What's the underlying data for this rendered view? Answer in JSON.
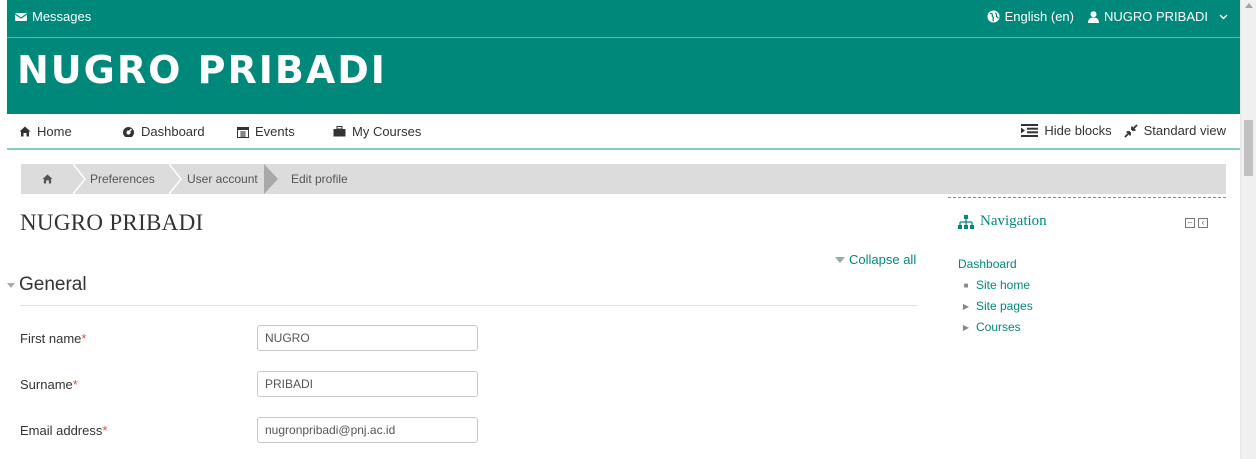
{
  "topbar": {
    "messages_label": "Messages",
    "language_label": "English (en)",
    "user_label": "NUGRO PRIBADI"
  },
  "header": {
    "site_name": "NUGRO PRIBADI"
  },
  "nav": {
    "items": [
      {
        "label": "Home",
        "icon": "home-icon"
      },
      {
        "label": "Dashboard",
        "icon": "dashboard-icon"
      },
      {
        "label": "Events",
        "icon": "calendar-icon"
      },
      {
        "label": "My Courses",
        "icon": "briefcase-icon"
      }
    ],
    "hide_blocks": "Hide blocks",
    "standard_view": "Standard view"
  },
  "breadcrumb": [
    "Preferences",
    "User account",
    "Edit profile"
  ],
  "main": {
    "title": "NUGRO PRIBADI",
    "collapse_all": "Collapse all",
    "section": "General",
    "fields": [
      {
        "label": "First name",
        "value": "NUGRO",
        "required": true
      },
      {
        "label": "Surname",
        "value": "PRIBADI",
        "required": true
      },
      {
        "label": "Email address",
        "value": "nugronpribadi@pnj.ac.id",
        "required": true
      }
    ],
    "required_marker": "*"
  },
  "navigation_block": {
    "title": "Navigation",
    "dashboard": "Dashboard",
    "items": [
      "Site home",
      "Site pages",
      "Courses"
    ]
  },
  "colors": {
    "brand": "#00897b",
    "required": "#d9534f"
  }
}
